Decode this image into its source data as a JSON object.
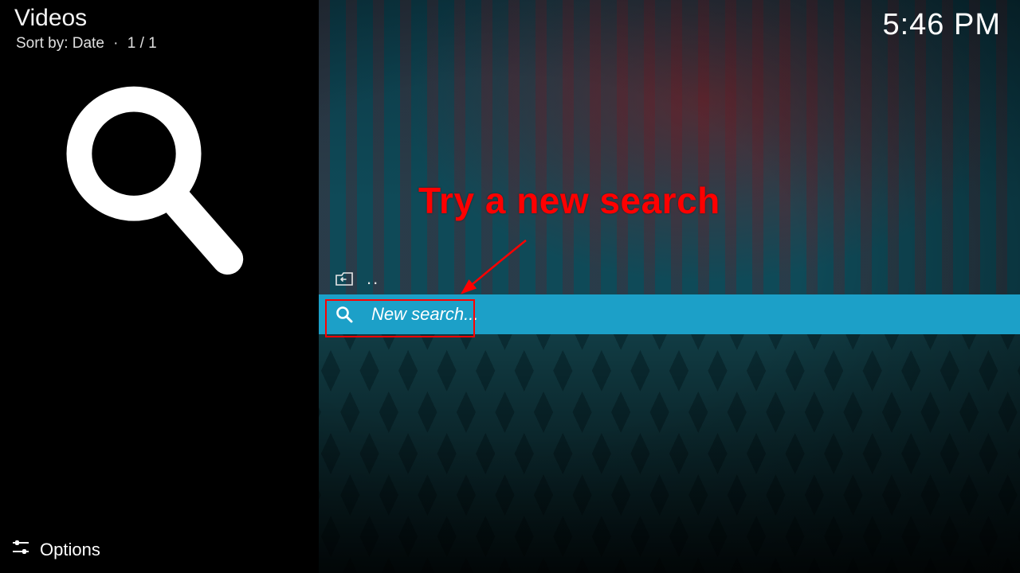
{
  "header": {
    "title": "Videos",
    "sort_label": "Sort by: Date",
    "page_indicator": "1 / 1",
    "separator": "·"
  },
  "clock": {
    "time": "5:46 PM"
  },
  "list": {
    "parent_label": "..",
    "new_search_label": "New search..."
  },
  "footer": {
    "options_label": "Options"
  },
  "annotation": {
    "text": "Try a new search"
  },
  "icons": {
    "big_search": "search-icon",
    "mini_search": "search-icon",
    "folder_back": "folder-back-icon",
    "options": "options-slider-icon"
  }
}
